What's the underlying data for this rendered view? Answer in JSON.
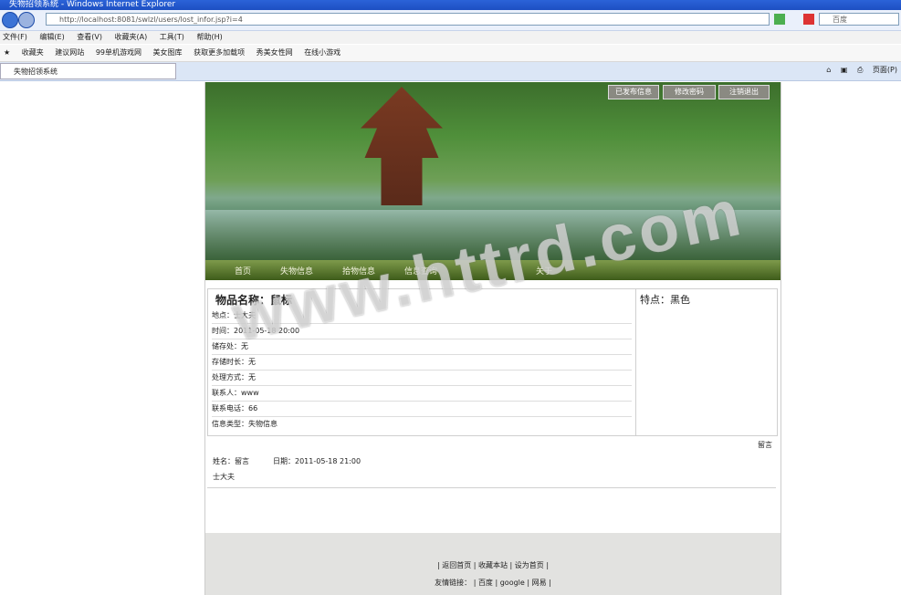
{
  "window": {
    "title": "失物招领系统 - Windows Internet Explorer"
  },
  "address_bar": {
    "url": "http://localhost:8081/swlzl/users/lost_infor.jsp?i=4",
    "search_placeholder": "百度"
  },
  "menu": [
    "文件(F)",
    "编辑(E)",
    "查看(V)",
    "收藏夹(A)",
    "工具(T)",
    "帮助(H)"
  ],
  "favorites": [
    "收藏夹",
    "建议网站",
    "99单机游戏网",
    "美女图库",
    "获取更多加载项",
    "秀美女性网",
    "在线小游戏"
  ],
  "tab": {
    "label": "失物招领系统"
  },
  "toolbar_right": {
    "page_label": "页面(P)"
  },
  "banner_buttons": [
    "已发布信息",
    "修改密码",
    "注销退出"
  ],
  "nav": [
    "首页",
    "失物信息",
    "拾物信息",
    "信息查询",
    "",
    "关于"
  ],
  "item": {
    "name_label": "物品名称：",
    "name": "鼠标",
    "feature_label": "特点：",
    "feature": "黑色",
    "rows": [
      "地点：士大夫",
      "时间：2011-05-18 20:00",
      "储存处：无",
      "存储时长：无",
      "处理方式：无",
      "联系人：www",
      "联系电话：66",
      "信息类型：失物信息"
    ]
  },
  "message": {
    "leave_msg": "留言",
    "author_line": "姓名：留言",
    "date_line": "日期：2011-05-18 21:00",
    "content": "士大夫"
  },
  "footer": {
    "links": [
      "返回首页",
      "收藏本站",
      "设为首页"
    ],
    "friend_label": "友情链接：",
    "friend_links": [
      "百度",
      "google",
      "网易"
    ]
  },
  "watermark": "www.httrd.com"
}
